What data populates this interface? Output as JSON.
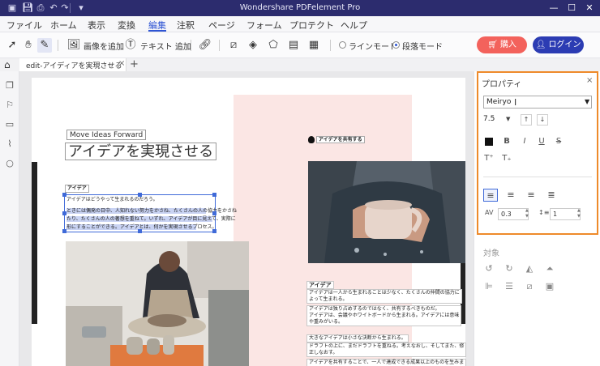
{
  "app": {
    "title": "Wondershare PDFelement Pro"
  },
  "quick_access": {
    "icons": [
      "save-icon",
      "print-icon",
      "undo-icon",
      "redo-icon",
      "customize-icon"
    ]
  },
  "window_controls": {
    "minimize": "—",
    "maximize": "☐",
    "close": "✕"
  },
  "menu": {
    "items": [
      "ファイル",
      "ホーム",
      "表示",
      "変換",
      "編集",
      "注釈",
      "ページ",
      "フォーム",
      "プロテクト",
      "ヘルプ"
    ],
    "active": "編集"
  },
  "toolbar": {
    "add_image": "画像を追加",
    "add_text": "テキスト 追加",
    "line_mode": "ラインモード",
    "paragraph_mode": "段落モード",
    "mode_selected": "段落モード",
    "buy": "購入",
    "login": "ログイン"
  },
  "tabs": {
    "doc_tab": "edit-アイディアを実現させる",
    "close": "×",
    "new": "+"
  },
  "document": {
    "heading_en": "Move Ideas Forward",
    "heading_jp": "アイデアを実現させる",
    "left_subheading": "アイデア",
    "left_paragraph": [
      "アイデアはどうやって生まれるのだろう。",
      "ときには偶発の日中、人知れない努力をかさね、たくさんの人の協力をかさね",
      "たり、たくさんの人の著想を重ねて。いずれ、アイデアが目に見えて、実際に",
      "形にすることができる。アイデアとは、何かを実現させるプロセス。"
    ],
    "right_top_label": "アイデアを共有する",
    "right_subheading": "アイデア",
    "right_blocks": [
      [
        "アイデアは一人から生まれることは少なく、たくさんの仲間の協力に",
        "よって生まれる。"
      ],
      [
        "アイデアは独り占めするのではなく、共有するべきものだ。",
        "アイデアは、会議やホワイトボードから生まれる。アイデアには意味",
        "や重みがいる。"
      ],
      [
        "大きなアイデアは小さな決断から生まれる。"
      ],
      [
        "ドラフトの上に、まだドラフトを重ねる。考えなおし、そしてまた、修",
        "正しなおす。"
      ],
      [
        "アイデアを共有することで、一人で達成できる成果以上のものを生みま"
      ]
    ]
  },
  "properties": {
    "title": "プロパティ",
    "close": "×",
    "font": "Meiryo",
    "font_size": "7.5",
    "text_color": "#111111",
    "char_spacing": "0.3",
    "line_spacing": "1",
    "align_selected": "left"
  },
  "objects": {
    "title": "対象"
  }
}
